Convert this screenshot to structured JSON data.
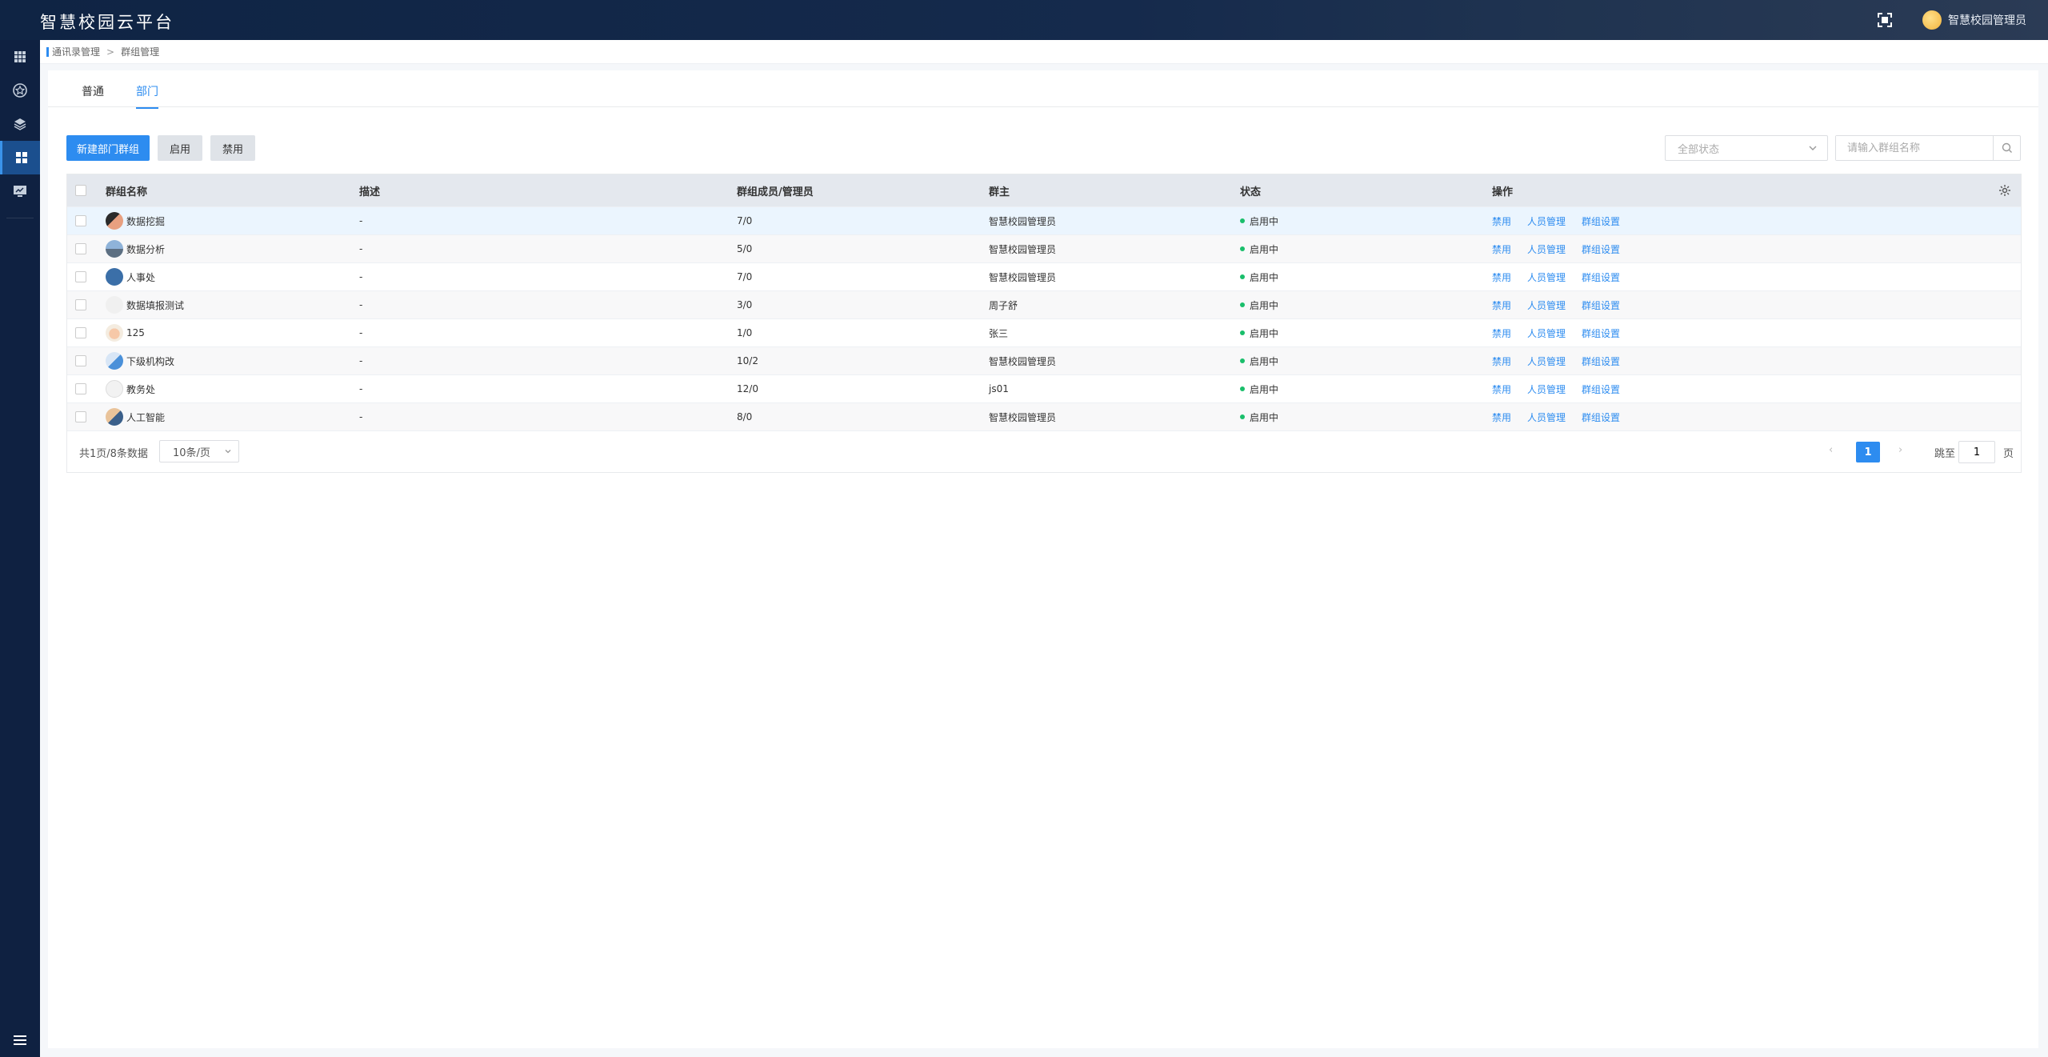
{
  "header": {
    "app_title": "智慧校园云平台",
    "user_name": "智慧校园管理员",
    "fullscreen_icon": "fullscreen-icon"
  },
  "sidebar": {
    "items": [
      {
        "icon": "apps-grid-icon",
        "active": false
      },
      {
        "icon": "star-badge-icon",
        "active": false
      },
      {
        "icon": "layers-icon",
        "active": false
      },
      {
        "icon": "dashboard-icon",
        "active": true
      },
      {
        "icon": "monitor-icon",
        "active": false
      }
    ],
    "bottom_icon": "menu-toggle-icon"
  },
  "breadcrumb": {
    "parent": "通讯录管理",
    "separator": ">",
    "current": "群组管理"
  },
  "tabs": [
    {
      "label": "普通",
      "active": false
    },
    {
      "label": "部门",
      "active": true
    }
  ],
  "toolbar": {
    "new_label": "新建部门群组",
    "enable_label": "启用",
    "disable_label": "禁用",
    "status_placeholder": "全部状态",
    "search_placeholder": "请输入群组名称"
  },
  "table": {
    "columns": {
      "name": "群组名称",
      "desc": "描述",
      "members": "群组成员/管理员",
      "owner": "群主",
      "status": "状态",
      "ops": "操作"
    },
    "rows": [
      {
        "name": "数据挖掘",
        "desc": "-",
        "members": "7/0",
        "owner": "智慧校园管理员",
        "status": "启用中"
      },
      {
        "name": "数据分析",
        "desc": "-",
        "members": "5/0",
        "owner": "智慧校园管理员",
        "status": "启用中"
      },
      {
        "name": "人事处",
        "desc": "-",
        "members": "7/0",
        "owner": "智慧校园管理员",
        "status": "启用中"
      },
      {
        "name": "数据填报测试",
        "desc": "-",
        "members": "3/0",
        "owner": "周子舒",
        "status": "启用中"
      },
      {
        "name": "125",
        "desc": "-",
        "members": "1/0",
        "owner": "张三",
        "status": "启用中"
      },
      {
        "name": "下级机构改",
        "desc": "-",
        "members": "10/2",
        "owner": "智慧校园管理员",
        "status": "启用中"
      },
      {
        "name": "教务处",
        "desc": "-",
        "members": "12/0",
        "owner": "js01",
        "status": "启用中"
      },
      {
        "name": "人工智能",
        "desc": "-",
        "members": "8/0",
        "owner": "智慧校园管理员",
        "status": "启用中"
      }
    ],
    "op_labels": {
      "disable": "禁用",
      "members": "人员管理",
      "settings": "群组设置"
    },
    "status_color": "#19be6b",
    "accent_color": "#2d8cf0"
  },
  "pager": {
    "total": "共1页/8条数据",
    "page_size": "10条/页",
    "current_page": "1",
    "jump_label": "跳至",
    "jump_value": "1",
    "jump_unit": "页"
  }
}
